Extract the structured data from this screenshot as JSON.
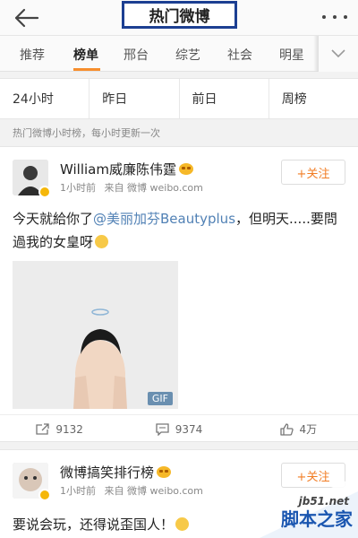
{
  "header": {
    "title": "热门微博"
  },
  "category_tabs": [
    "推荐",
    "榜单",
    "邢台",
    "综艺",
    "社会",
    "明星"
  ],
  "active_category": "榜单",
  "time_filters": [
    "24小时",
    "昨日",
    "前日",
    "周榜"
  ],
  "hint": "热门微博小时榜，每小时更新一次",
  "posts": [
    {
      "username": "William威廉陈伟霆",
      "time": "1小时前",
      "source": "来自 微博 weibo.com",
      "follow_label": "+关注",
      "text_before": "今天就給你了",
      "mention": "@美丽加芬Beautyplus",
      "text_after": "，但明天.....要問過我的女皇呀",
      "media_tag": "GIF",
      "reposts": "9132",
      "comments": "9374",
      "likes": "4万"
    },
    {
      "username": "微博搞笑排行榜",
      "time": "1小时前",
      "source": "来自 微博 weibo.com",
      "follow_label": "+关注",
      "text": "要说会玩，还得说歪国人！"
    }
  ],
  "watermark": {
    "url": "jb51.net",
    "text": "脚本之家"
  },
  "colors": {
    "accent": "#f78e2d",
    "follow": "#f27d24",
    "mention": "#5181b5",
    "title_border": "#1c3f92"
  }
}
